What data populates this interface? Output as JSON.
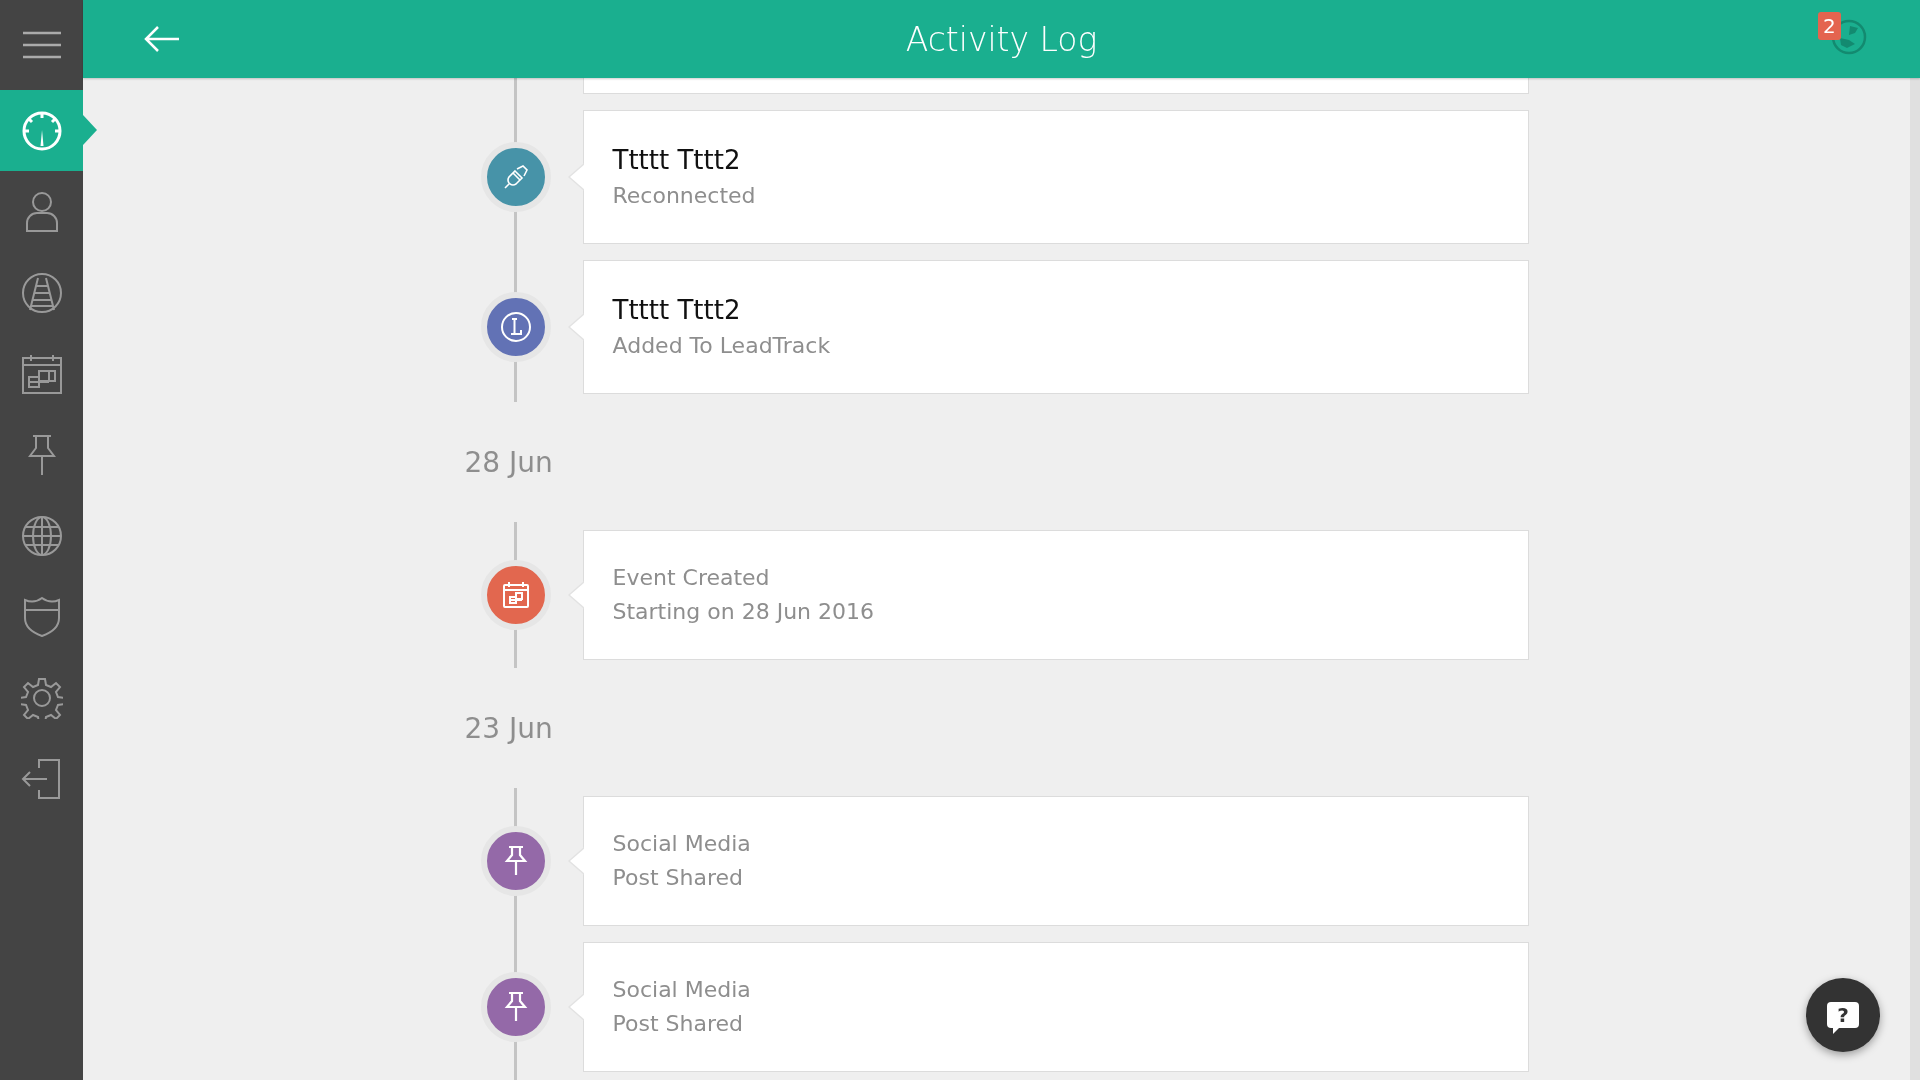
{
  "header": {
    "title": "Activity Log",
    "notification_count": "2"
  },
  "sidebar": {
    "items": [
      {
        "kind": "dashboard",
        "selected": true
      },
      {
        "kind": "user",
        "selected": false
      },
      {
        "kind": "road",
        "selected": false
      },
      {
        "kind": "calendar",
        "selected": false
      },
      {
        "kind": "pin",
        "selected": false
      },
      {
        "kind": "globe",
        "selected": false
      },
      {
        "kind": "shield",
        "selected": false
      },
      {
        "kind": "settings",
        "selected": false
      },
      {
        "kind": "logout",
        "selected": false
      }
    ]
  },
  "timeline": [
    {
      "kind": "clipped"
    },
    {
      "kind": "connection",
      "color": "#4793a8",
      "title": "Ttttt Tttt2",
      "lines": [
        "Reconnected"
      ]
    },
    {
      "kind": "lead",
      "color": "#6272b5",
      "title": "Ttttt Tttt2",
      "lines": [
        "Added To LeadTrack"
      ]
    },
    {
      "kind": "date",
      "label": "28 Jun"
    },
    {
      "kind": "event",
      "color": "#e2674f",
      "lines": [
        "Event Created",
        "Starting on 28 Jun 2016"
      ]
    },
    {
      "kind": "date",
      "label": "23 Jun"
    },
    {
      "kind": "social",
      "color": "#9469a8",
      "lines": [
        "Social Media",
        "Post Shared"
      ]
    },
    {
      "kind": "social",
      "color": "#9469a8",
      "lines": [
        "Social Media",
        "Post Shared"
      ]
    }
  ],
  "help_button": {
    "label": "?"
  }
}
